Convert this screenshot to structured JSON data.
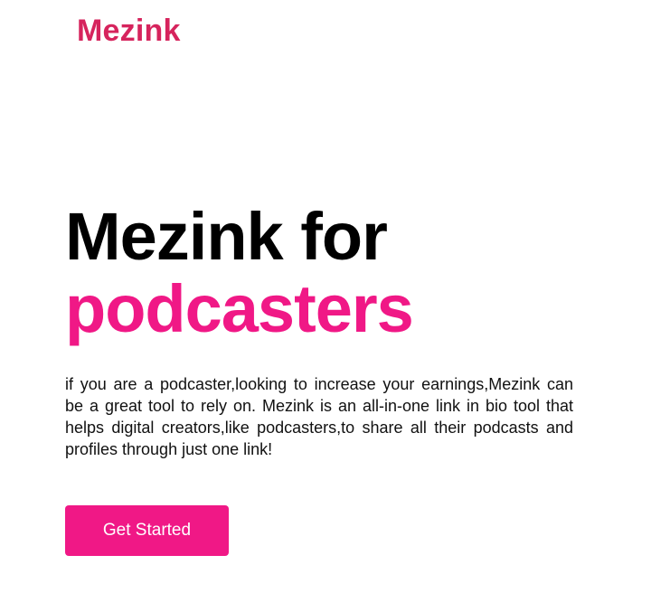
{
  "header": {
    "logo_text": "Mezink"
  },
  "hero": {
    "title_line1": "Mezink for",
    "title_line2": "podcasters",
    "description": "if you are a podcaster,looking to increase your earnings,Mezink can be a great tool to rely on. Mezink is an all-in-one link in bio tool that helps digital creators,like podcasters,to share all their podcasts and profiles through just one link!",
    "cta_label": "Get Started"
  },
  "colors": {
    "logo": "#d6245d",
    "accent": "#f01886",
    "title": "#000000",
    "body_text": "#111111"
  }
}
